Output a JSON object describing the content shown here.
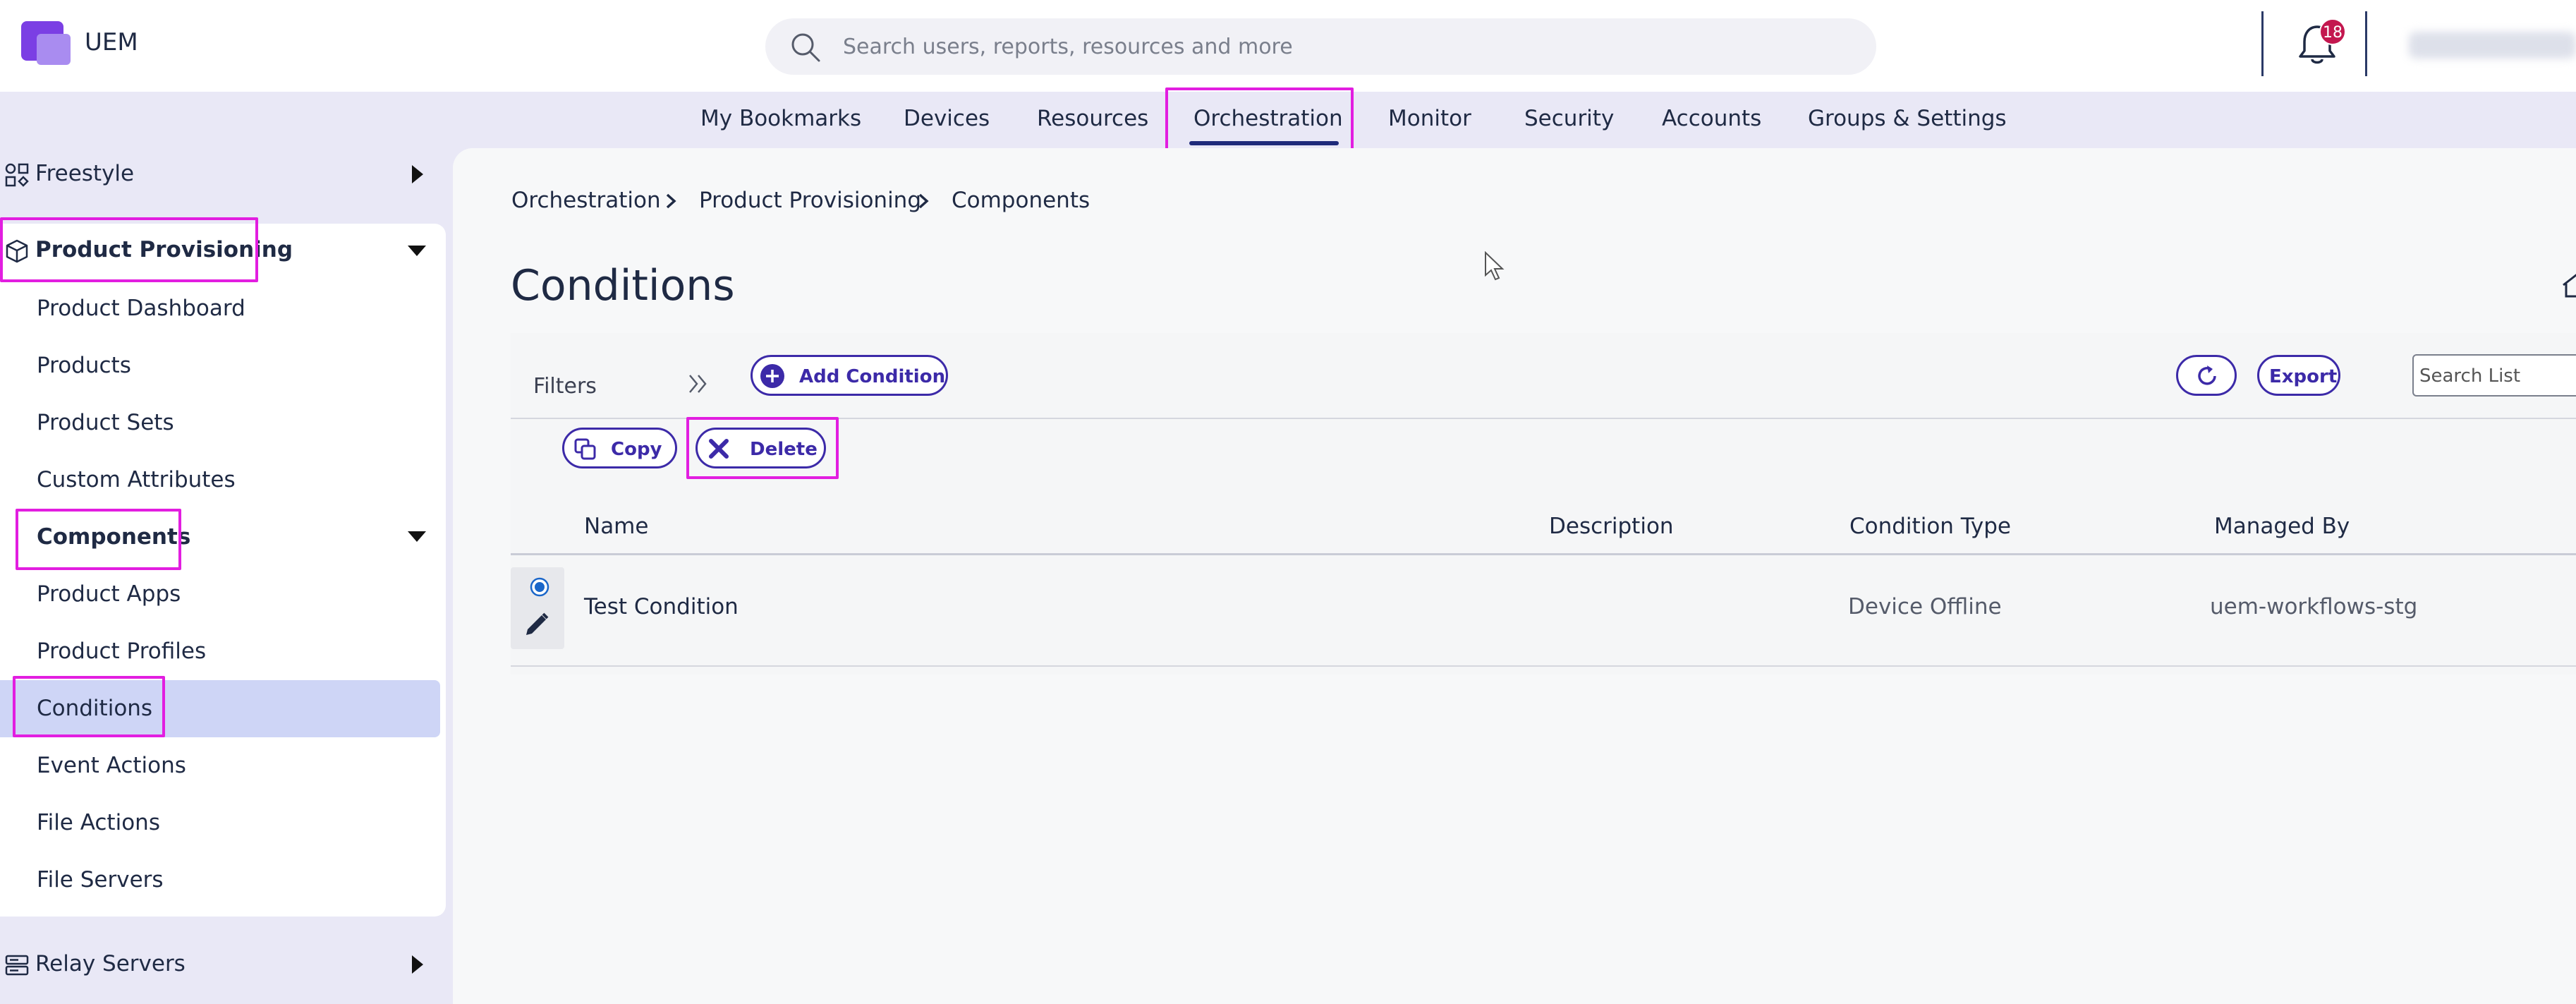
{
  "app": {
    "name": "UEM"
  },
  "search": {
    "placeholder": "Search users, reports, resources and more"
  },
  "notifications": {
    "count": "18"
  },
  "topnav": {
    "items": [
      {
        "label": "My Bookmarks"
      },
      {
        "label": "Devices"
      },
      {
        "label": "Resources"
      },
      {
        "label": "Orchestration"
      },
      {
        "label": "Monitor"
      },
      {
        "label": "Security"
      },
      {
        "label": "Accounts"
      },
      {
        "label": "Groups & Settings"
      }
    ],
    "active": "Orchestration"
  },
  "sidebar": {
    "freestyle": "Freestyle",
    "product_provisioning": "Product Provisioning",
    "items": [
      "Product Dashboard",
      "Products",
      "Product Sets",
      "Custom Attributes",
      "Components",
      "Product Apps",
      "Product Profiles",
      "Conditions",
      "Event Actions",
      "File Actions",
      "File Servers"
    ],
    "relay_servers": "Relay Servers",
    "active": "Conditions"
  },
  "breadcrumb": [
    "Orchestration",
    "Product Provisioning",
    "Components"
  ],
  "page": {
    "title": "Conditions"
  },
  "toolbar": {
    "filters": "Filters",
    "add_condition": "Add Condition",
    "export": "Export",
    "search_placeholder": "Search List",
    "copy": "Copy",
    "delete": "Delete"
  },
  "table": {
    "columns": [
      "Name",
      "Description",
      "Condition Type",
      "Managed By"
    ],
    "rows": [
      {
        "name": "Test Condition",
        "description": "",
        "condition_type": "Device Offline",
        "managed_by": "uem-workflows-stg"
      }
    ]
  },
  "colors": {
    "accent": "#3c2aa8",
    "highlight": "#e21ee0",
    "active_row": "#ced5f6",
    "badge": "#c3174f"
  }
}
